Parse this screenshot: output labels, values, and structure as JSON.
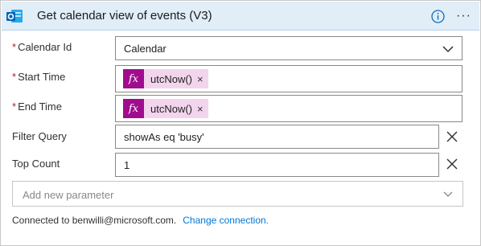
{
  "header": {
    "title": "Get calendar view of events (V3)",
    "app_icon": "outlook-icon",
    "info_icon": "info-icon",
    "more_label": "···",
    "header_bg": "#e1edf7",
    "brand_color": "#0f6cbd"
  },
  "fields": {
    "calendar_id": {
      "label": "Calendar Id",
      "required_mark": "*",
      "value": "Calendar"
    },
    "start_time": {
      "label": "Start Time",
      "required_mark": "*",
      "token_label": "utcNow()",
      "token_icon": "fx"
    },
    "end_time": {
      "label": "End Time",
      "required_mark": "*",
      "token_label": "utcNow()",
      "token_icon": "fx"
    },
    "filter_query": {
      "label": "Filter Query",
      "value": "showAs eq 'busy'"
    },
    "top_count": {
      "label": "Top Count",
      "value": "1"
    }
  },
  "token": {
    "remove": "×",
    "fx_color": "#a10c8f",
    "bg_color": "#f2d5ec"
  },
  "add_parameter": {
    "placeholder": "Add new parameter"
  },
  "footer": {
    "connected_text": "Connected to benwilli@microsoft.com.",
    "change_link": "Change connection."
  },
  "colors": {
    "required": "#a4262c",
    "link": "#0078d4"
  }
}
